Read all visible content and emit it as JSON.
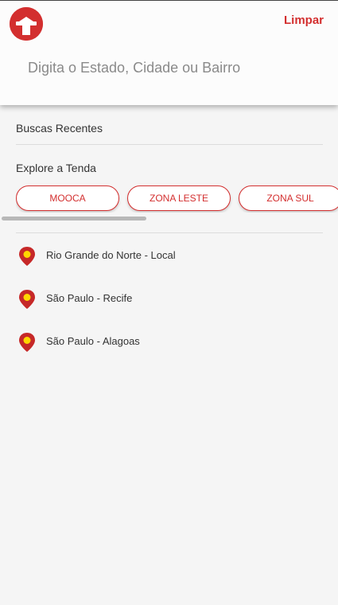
{
  "header": {
    "clear_label": "Limpar",
    "search_placeholder": "Digita o Estado, Cidade ou Bairro",
    "search_value": ""
  },
  "recent": {
    "title": "Buscas Recentes"
  },
  "explore": {
    "title": "Explore a Tenda",
    "chips": [
      "MOOCA",
      "ZONA LESTE",
      "ZONA SUL"
    ]
  },
  "locations": [
    {
      "label": "Rio Grande do Norte - Local"
    },
    {
      "label": "São Paulo - Recife"
    },
    {
      "label": "São Paulo - Alagoas"
    }
  ],
  "colors": {
    "accent": "#d32f2f",
    "pin_center": "#ffd600",
    "background": "#f5f5f5"
  },
  "icons": {
    "logo": "tenda-logo-icon",
    "location": "map-pin-icon"
  }
}
